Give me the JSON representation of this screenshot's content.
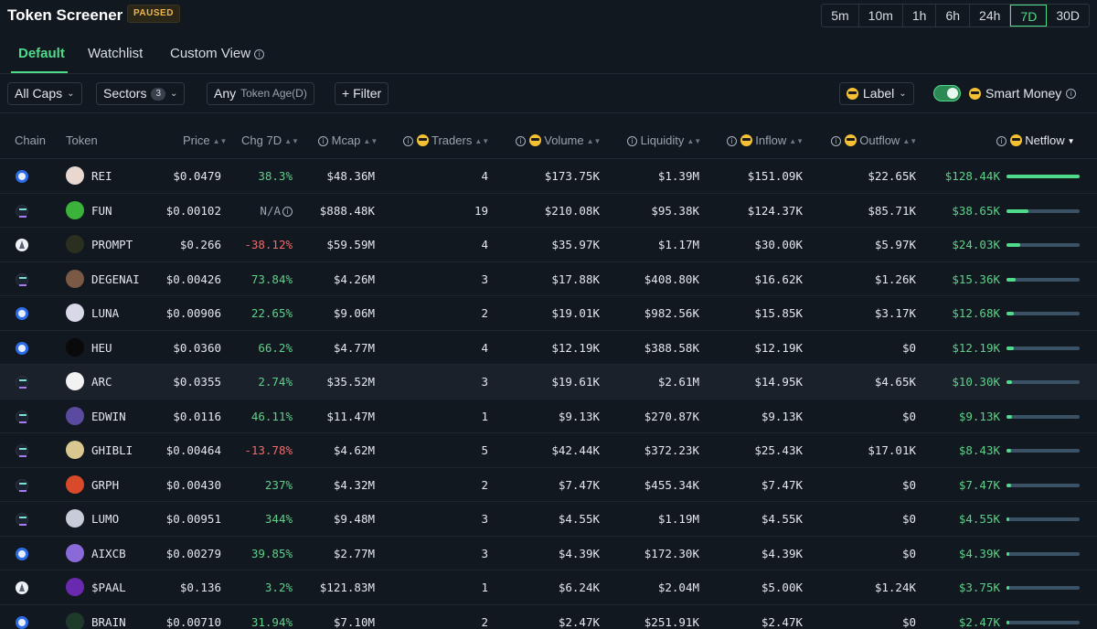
{
  "header": {
    "title": "Token Screener",
    "status_badge": "PAUSED",
    "timeframes": [
      "5m",
      "10m",
      "1h",
      "6h",
      "24h",
      "7D",
      "30D"
    ],
    "active_timeframe": "7D"
  },
  "tabs": [
    {
      "label": "Default",
      "active": true
    },
    {
      "label": "Watchlist",
      "active": false
    },
    {
      "label": "Custom View",
      "active": false
    }
  ],
  "filters": {
    "caps": "All Caps",
    "sectors": "Sectors",
    "sectors_count": "3",
    "age_value": "Any",
    "age_label": "Token Age(D)",
    "filter_button": "+ Filter",
    "label_dropdown": "Label",
    "smart_money": "Smart Money",
    "smart_money_enabled": true
  },
  "columns": {
    "chain": "Chain",
    "token": "Token",
    "price": "Price",
    "chg": "Chg 7D",
    "mcap": "Mcap",
    "traders": "Traders",
    "volume": "Volume",
    "liquidity": "Liquidity",
    "inflow": "Inflow",
    "outflow": "Outflow",
    "netflow": "Netflow"
  },
  "colors": {
    "accent": "#4fdc8a",
    "negative": "#ef6a6a",
    "paused": "#f0b44c"
  },
  "rows": [
    {
      "chain": "base",
      "token": "REI",
      "icon_color": "#e8d8d0",
      "price": "$0.0479",
      "chg": "38.3%",
      "chg_dir": "pos",
      "mcap": "$48.36M",
      "traders": "4",
      "volume": "$173.75K",
      "liquidity": "$1.39M",
      "inflow": "$151.09K",
      "outflow": "$22.65K",
      "netflow": "$128.44K",
      "netflow_value": 128.44
    },
    {
      "chain": "solana",
      "token": "FUN",
      "icon_color": "#3bb33b",
      "price": "$0.00102",
      "chg": "N/A",
      "chg_dir": "na",
      "mcap": "$888.48K",
      "traders": "19",
      "volume": "$210.08K",
      "liquidity": "$95.38K",
      "inflow": "$124.37K",
      "outflow": "$85.71K",
      "netflow": "$38.65K",
      "netflow_value": 38.65
    },
    {
      "chain": "ethereum",
      "token": "PROMPT",
      "icon_color": "#2a2f20",
      "price": "$0.266",
      "chg": "-38.12%",
      "chg_dir": "neg",
      "mcap": "$59.59M",
      "traders": "4",
      "volume": "$35.97K",
      "liquidity": "$1.17M",
      "inflow": "$30.00K",
      "outflow": "$5.97K",
      "netflow": "$24.03K",
      "netflow_value": 24.03
    },
    {
      "chain": "solana",
      "token": "DEGENAI",
      "icon_color": "#7a5a44",
      "price": "$0.00426",
      "chg": "73.84%",
      "chg_dir": "pos",
      "mcap": "$4.26M",
      "traders": "3",
      "volume": "$17.88K",
      "liquidity": "$408.80K",
      "inflow": "$16.62K",
      "outflow": "$1.26K",
      "netflow": "$15.36K",
      "netflow_value": 15.36
    },
    {
      "chain": "base",
      "token": "LUNA",
      "icon_color": "#d8d8e8",
      "price": "$0.00906",
      "chg": "22.65%",
      "chg_dir": "pos",
      "mcap": "$9.06M",
      "traders": "2",
      "volume": "$19.01K",
      "liquidity": "$982.56K",
      "inflow": "$15.85K",
      "outflow": "$3.17K",
      "netflow": "$12.68K",
      "netflow_value": 12.68
    },
    {
      "chain": "base",
      "token": "HEU",
      "icon_color": "#0a0a0a",
      "price": "$0.0360",
      "chg": "66.2%",
      "chg_dir": "pos",
      "mcap": "$4.77M",
      "traders": "4",
      "volume": "$12.19K",
      "liquidity": "$388.58K",
      "inflow": "$12.19K",
      "outflow": "$0",
      "netflow": "$12.19K",
      "netflow_value": 12.19
    },
    {
      "chain": "solana",
      "token": "ARC",
      "icon_color": "#f2f2f2",
      "price": "$0.0355",
      "chg": "2.74%",
      "chg_dir": "pos",
      "mcap": "$35.52M",
      "traders": "3",
      "volume": "$19.61K",
      "liquidity": "$2.61M",
      "inflow": "$14.95K",
      "outflow": "$4.65K",
      "netflow": "$10.30K",
      "netflow_value": 10.3,
      "highlight": true
    },
    {
      "chain": "solana",
      "token": "EDWIN",
      "icon_color": "#5a4aa0",
      "price": "$0.0116",
      "chg": "46.11%",
      "chg_dir": "pos",
      "mcap": "$11.47M",
      "traders": "1",
      "volume": "$9.13K",
      "liquidity": "$270.87K",
      "inflow": "$9.13K",
      "outflow": "$0",
      "netflow": "$9.13K",
      "netflow_value": 9.13
    },
    {
      "chain": "solana",
      "token": "GHIBLI",
      "icon_color": "#d8c890",
      "price": "$0.00464",
      "chg": "-13.78%",
      "chg_dir": "neg",
      "mcap": "$4.62M",
      "traders": "5",
      "volume": "$42.44K",
      "liquidity": "$372.23K",
      "inflow": "$25.43K",
      "outflow": "$17.01K",
      "netflow": "$8.43K",
      "netflow_value": 8.43
    },
    {
      "chain": "solana",
      "token": "GRPH",
      "icon_color": "#d84a2a",
      "price": "$0.00430",
      "chg": "237%",
      "chg_dir": "pos",
      "mcap": "$4.32M",
      "traders": "2",
      "volume": "$7.47K",
      "liquidity": "$455.34K",
      "inflow": "$7.47K",
      "outflow": "$0",
      "netflow": "$7.47K",
      "netflow_value": 7.47
    },
    {
      "chain": "solana",
      "token": "LUMO",
      "icon_color": "#c8ccd8",
      "price": "$0.00951",
      "chg": "344%",
      "chg_dir": "pos",
      "mcap": "$9.48M",
      "traders": "3",
      "volume": "$4.55K",
      "liquidity": "$1.19M",
      "inflow": "$4.55K",
      "outflow": "$0",
      "netflow": "$4.55K",
      "netflow_value": 4.55
    },
    {
      "chain": "base",
      "token": "AIXCB",
      "icon_color": "#8a6ad8",
      "price": "$0.00279",
      "chg": "39.85%",
      "chg_dir": "pos",
      "mcap": "$2.77M",
      "traders": "3",
      "volume": "$4.39K",
      "liquidity": "$172.30K",
      "inflow": "$4.39K",
      "outflow": "$0",
      "netflow": "$4.39K",
      "netflow_value": 4.39
    },
    {
      "chain": "ethereum",
      "token": "$PAAL",
      "icon_color": "#6a2ab0",
      "price": "$0.136",
      "chg": "3.2%",
      "chg_dir": "pos",
      "mcap": "$121.83M",
      "traders": "1",
      "volume": "$6.24K",
      "liquidity": "$2.04M",
      "inflow": "$5.00K",
      "outflow": "$1.24K",
      "netflow": "$3.75K",
      "netflow_value": 3.75
    },
    {
      "chain": "base",
      "token": "BRAIN",
      "icon_color": "#1e3a2a",
      "price": "$0.00710",
      "chg": "31.94%",
      "chg_dir": "pos",
      "mcap": "$7.10M",
      "traders": "2",
      "volume": "$2.47K",
      "liquidity": "$251.91K",
      "inflow": "$2.47K",
      "outflow": "$0",
      "netflow": "$2.47K",
      "netflow_value": 2.47
    }
  ]
}
